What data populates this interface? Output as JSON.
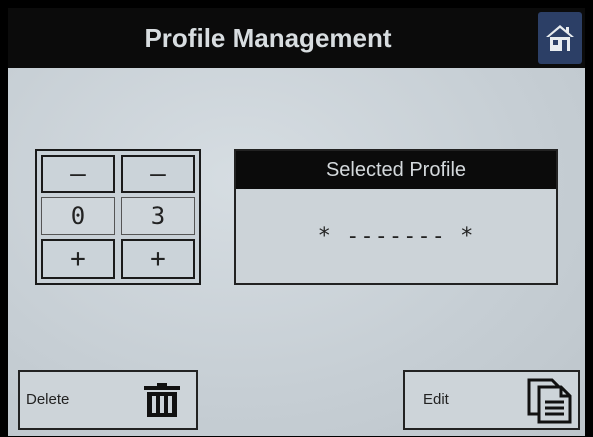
{
  "header": {
    "title": "Profile Management",
    "home_icon": "home-icon"
  },
  "stepper": {
    "minus_label": "—",
    "plus_label": "+",
    "digits": [
      "0",
      "3"
    ]
  },
  "selected_profile": {
    "header": "Selected Profile",
    "value": "* ------- *"
  },
  "actions": {
    "delete_label": "Delete",
    "delete_icon": "trash-icon",
    "edit_label": "Edit",
    "edit_icon": "document-icon"
  },
  "colors": {
    "titlebar": "#0b0b0b",
    "home_button": "#2c3f66",
    "screen_bg": "#c8d0d6"
  }
}
